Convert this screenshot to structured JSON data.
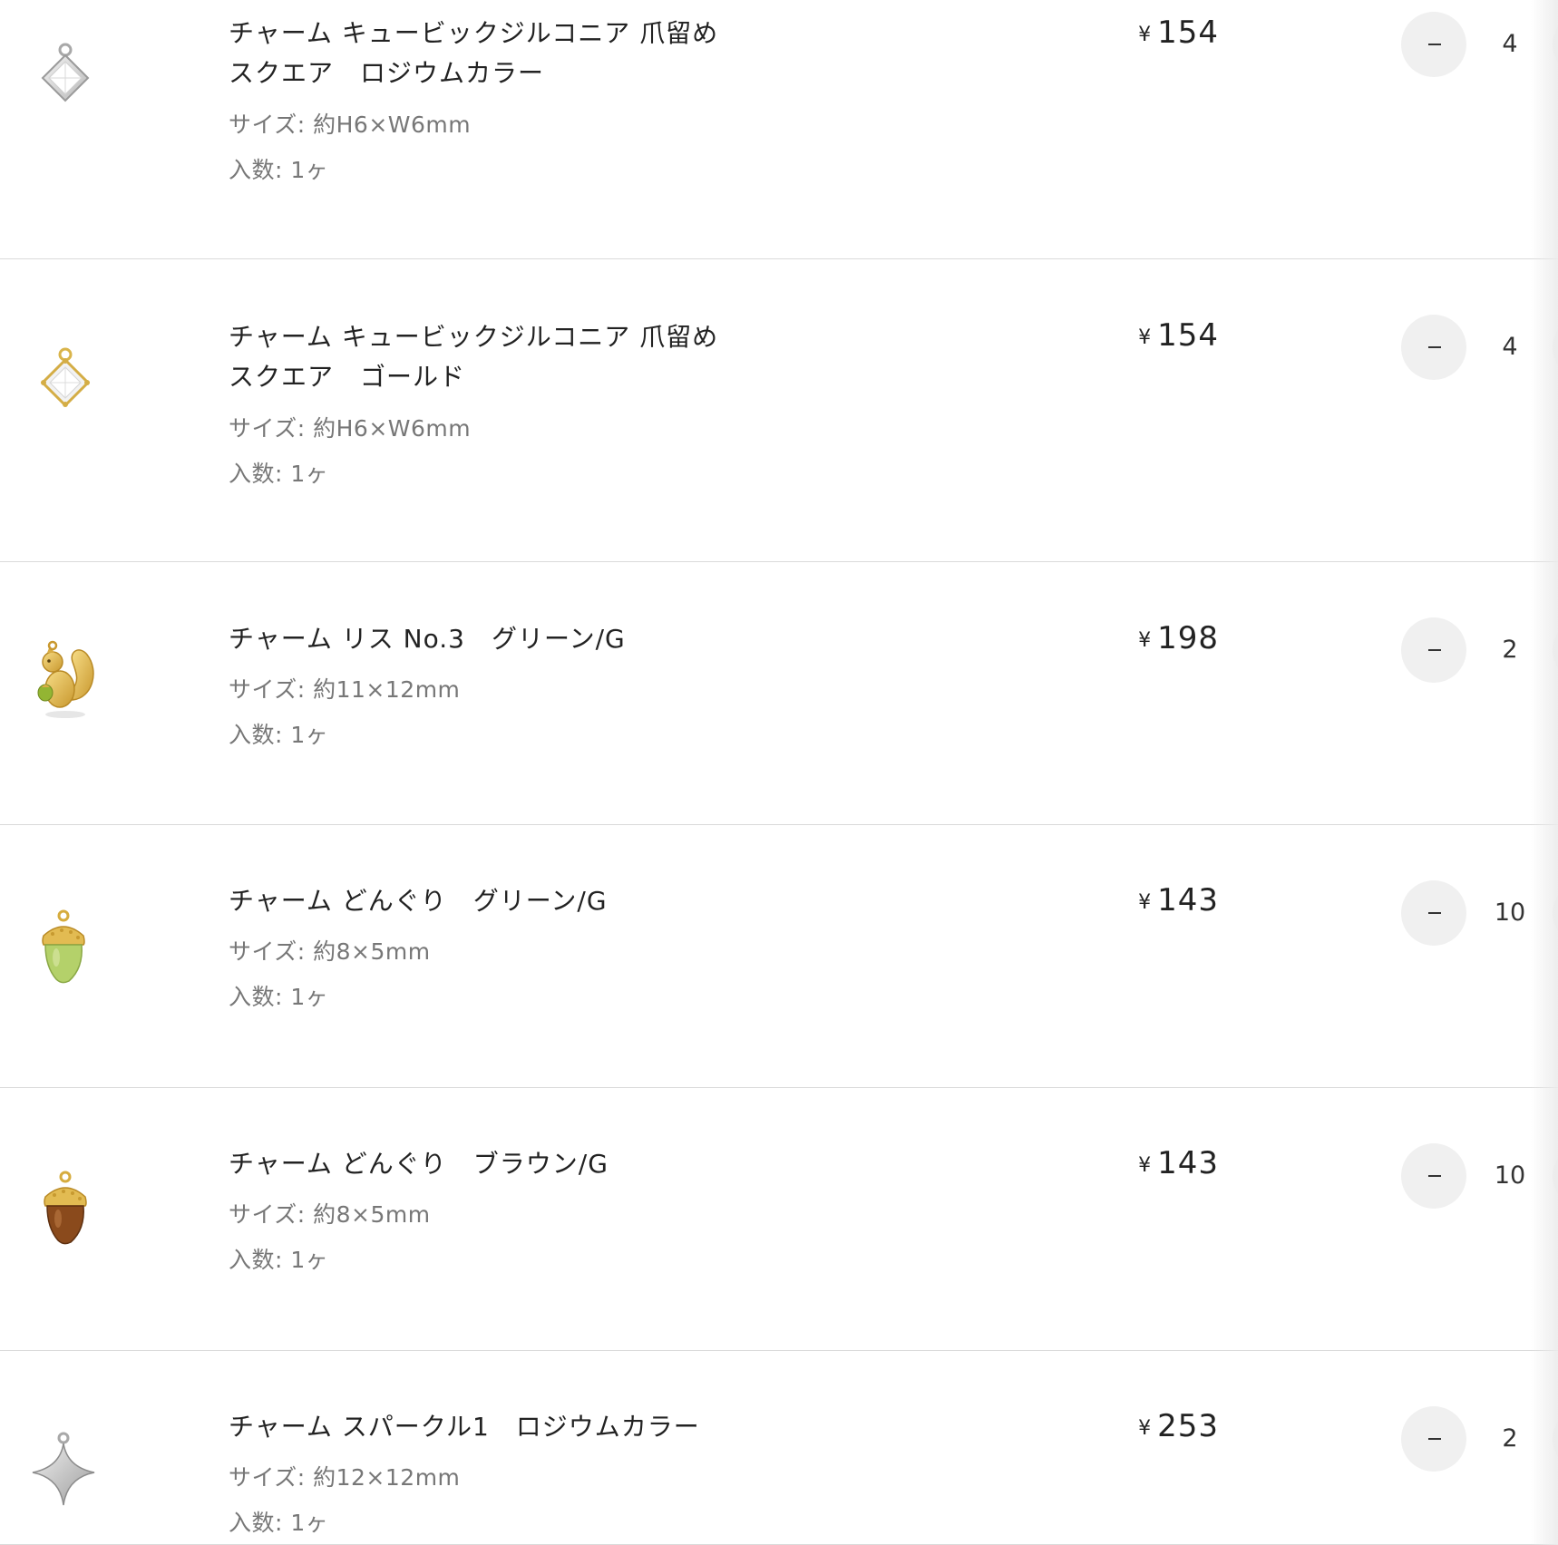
{
  "cart": {
    "items": [
      {
        "name": "チャーム キュービックジルコニア 爪留め\nスクエア　ロジウムカラー",
        "size": "サイズ: 約H6×W6mm",
        "count": "入数: 1ヶ",
        "currency": "¥",
        "price": "154",
        "quantity": "4",
        "image_icon": "silver-square-cz-charm-icon"
      },
      {
        "name": "チャーム キュービックジルコニア 爪留め\nスクエア　ゴールド",
        "size": "サイズ: 約H6×W6mm",
        "count": "入数: 1ヶ",
        "currency": "¥",
        "price": "154",
        "quantity": "4",
        "image_icon": "gold-square-cz-charm-icon"
      },
      {
        "name": "チャーム リス No.3　グリーン/G",
        "size": "サイズ: 約11×12mm",
        "count": "入数: 1ヶ",
        "currency": "¥",
        "price": "198",
        "quantity": "2",
        "image_icon": "squirrel-charm-icon"
      },
      {
        "name": "チャーム どんぐり　グリーン/G",
        "size": "サイズ: 約8×5mm",
        "count": "入数: 1ヶ",
        "currency": "¥",
        "price": "143",
        "quantity": "10",
        "image_icon": "green-acorn-charm-icon"
      },
      {
        "name": "チャーム どんぐり　ブラウン/G",
        "size": "サイズ: 約8×5mm",
        "count": "入数: 1ヶ",
        "currency": "¥",
        "price": "143",
        "quantity": "10",
        "image_icon": "brown-acorn-charm-icon"
      },
      {
        "name": "チャーム スパークル1　ロジウムカラー",
        "size": "サイズ: 約12×12mm",
        "count": "入数: 1ヶ",
        "currency": "¥",
        "price": "253",
        "quantity": "2",
        "image_icon": "silver-sparkle-charm-icon"
      }
    ]
  },
  "colors": {
    "divider": "#dadada",
    "button_bg": "#f0f0f0",
    "text": "#222222",
    "muted": "#777777"
  }
}
